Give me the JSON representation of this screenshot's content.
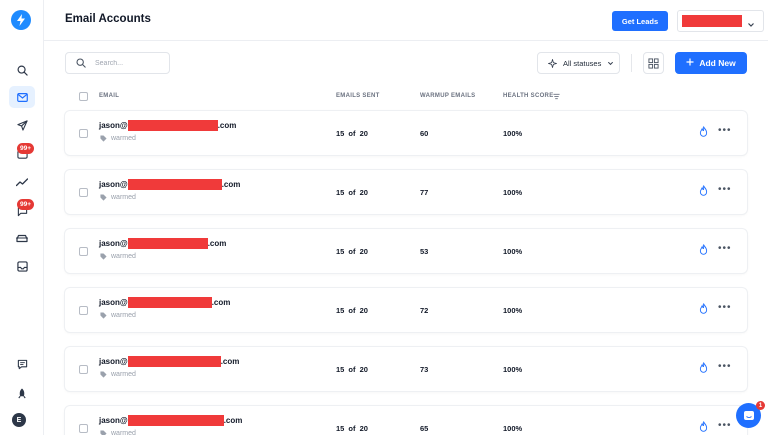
{
  "header": {
    "title": "Email Accounts",
    "get_leads_label": "Get Leads"
  },
  "sidebar": {
    "badge_1": "99+",
    "badge_2": "99+",
    "avatar_initial": "E"
  },
  "toolbar": {
    "search_placeholder": "Search...",
    "status_filter_label": "All statuses",
    "add_new_label": "Add New"
  },
  "table": {
    "columns": {
      "email": "EMAIL",
      "emails_sent": "EMAILS SENT",
      "warmup_emails": "WARMUP EMAILS",
      "health_score": "HEALTH SCORE"
    },
    "rows": [
      {
        "email_prefix": "jason@",
        "email_suffix": ".com",
        "tag": "warmed",
        "emails_sent": "15 of 20",
        "warmup_emails": "60",
        "health_score": "100%"
      },
      {
        "email_prefix": "jason@",
        "email_suffix": ".com",
        "tag": "warmed",
        "emails_sent": "15 of 20",
        "warmup_emails": "77",
        "health_score": "100%"
      },
      {
        "email_prefix": "jason@",
        "email_suffix": ".com",
        "tag": "warmed",
        "emails_sent": "15 of 20",
        "warmup_emails": "53",
        "health_score": "100%"
      },
      {
        "email_prefix": "jason@",
        "email_suffix": ".com",
        "tag": "warmed",
        "emails_sent": "15 of 20",
        "warmup_emails": "72",
        "health_score": "100%"
      },
      {
        "email_prefix": "jason@",
        "email_suffix": ".com",
        "tag": "warmed",
        "emails_sent": "15 of 20",
        "warmup_emails": "73",
        "health_score": "100%"
      },
      {
        "email_prefix": "jason@",
        "email_suffix": ".com",
        "tag": "warmed",
        "emails_sent": "15 of 20",
        "warmup_emails": "65",
        "health_score": "100%"
      }
    ]
  },
  "chat": {
    "badge": "1"
  },
  "colors": {
    "accent": "#1f6fff",
    "logo": "#1f8bff",
    "badge": "#e53935",
    "redaction": "#f03a3a"
  },
  "icons": {
    "logo": "lightning-logo-icon",
    "nav": [
      "search-icon",
      "mail-icon",
      "send-icon",
      "unibox-icon",
      "analytics-icon",
      "chat-icon",
      "car-icon",
      "inbox-icon"
    ],
    "bottom": [
      "feedback-icon",
      "rocket-icon"
    ],
    "row_actions": [
      "fire-icon",
      "more-icon"
    ]
  }
}
